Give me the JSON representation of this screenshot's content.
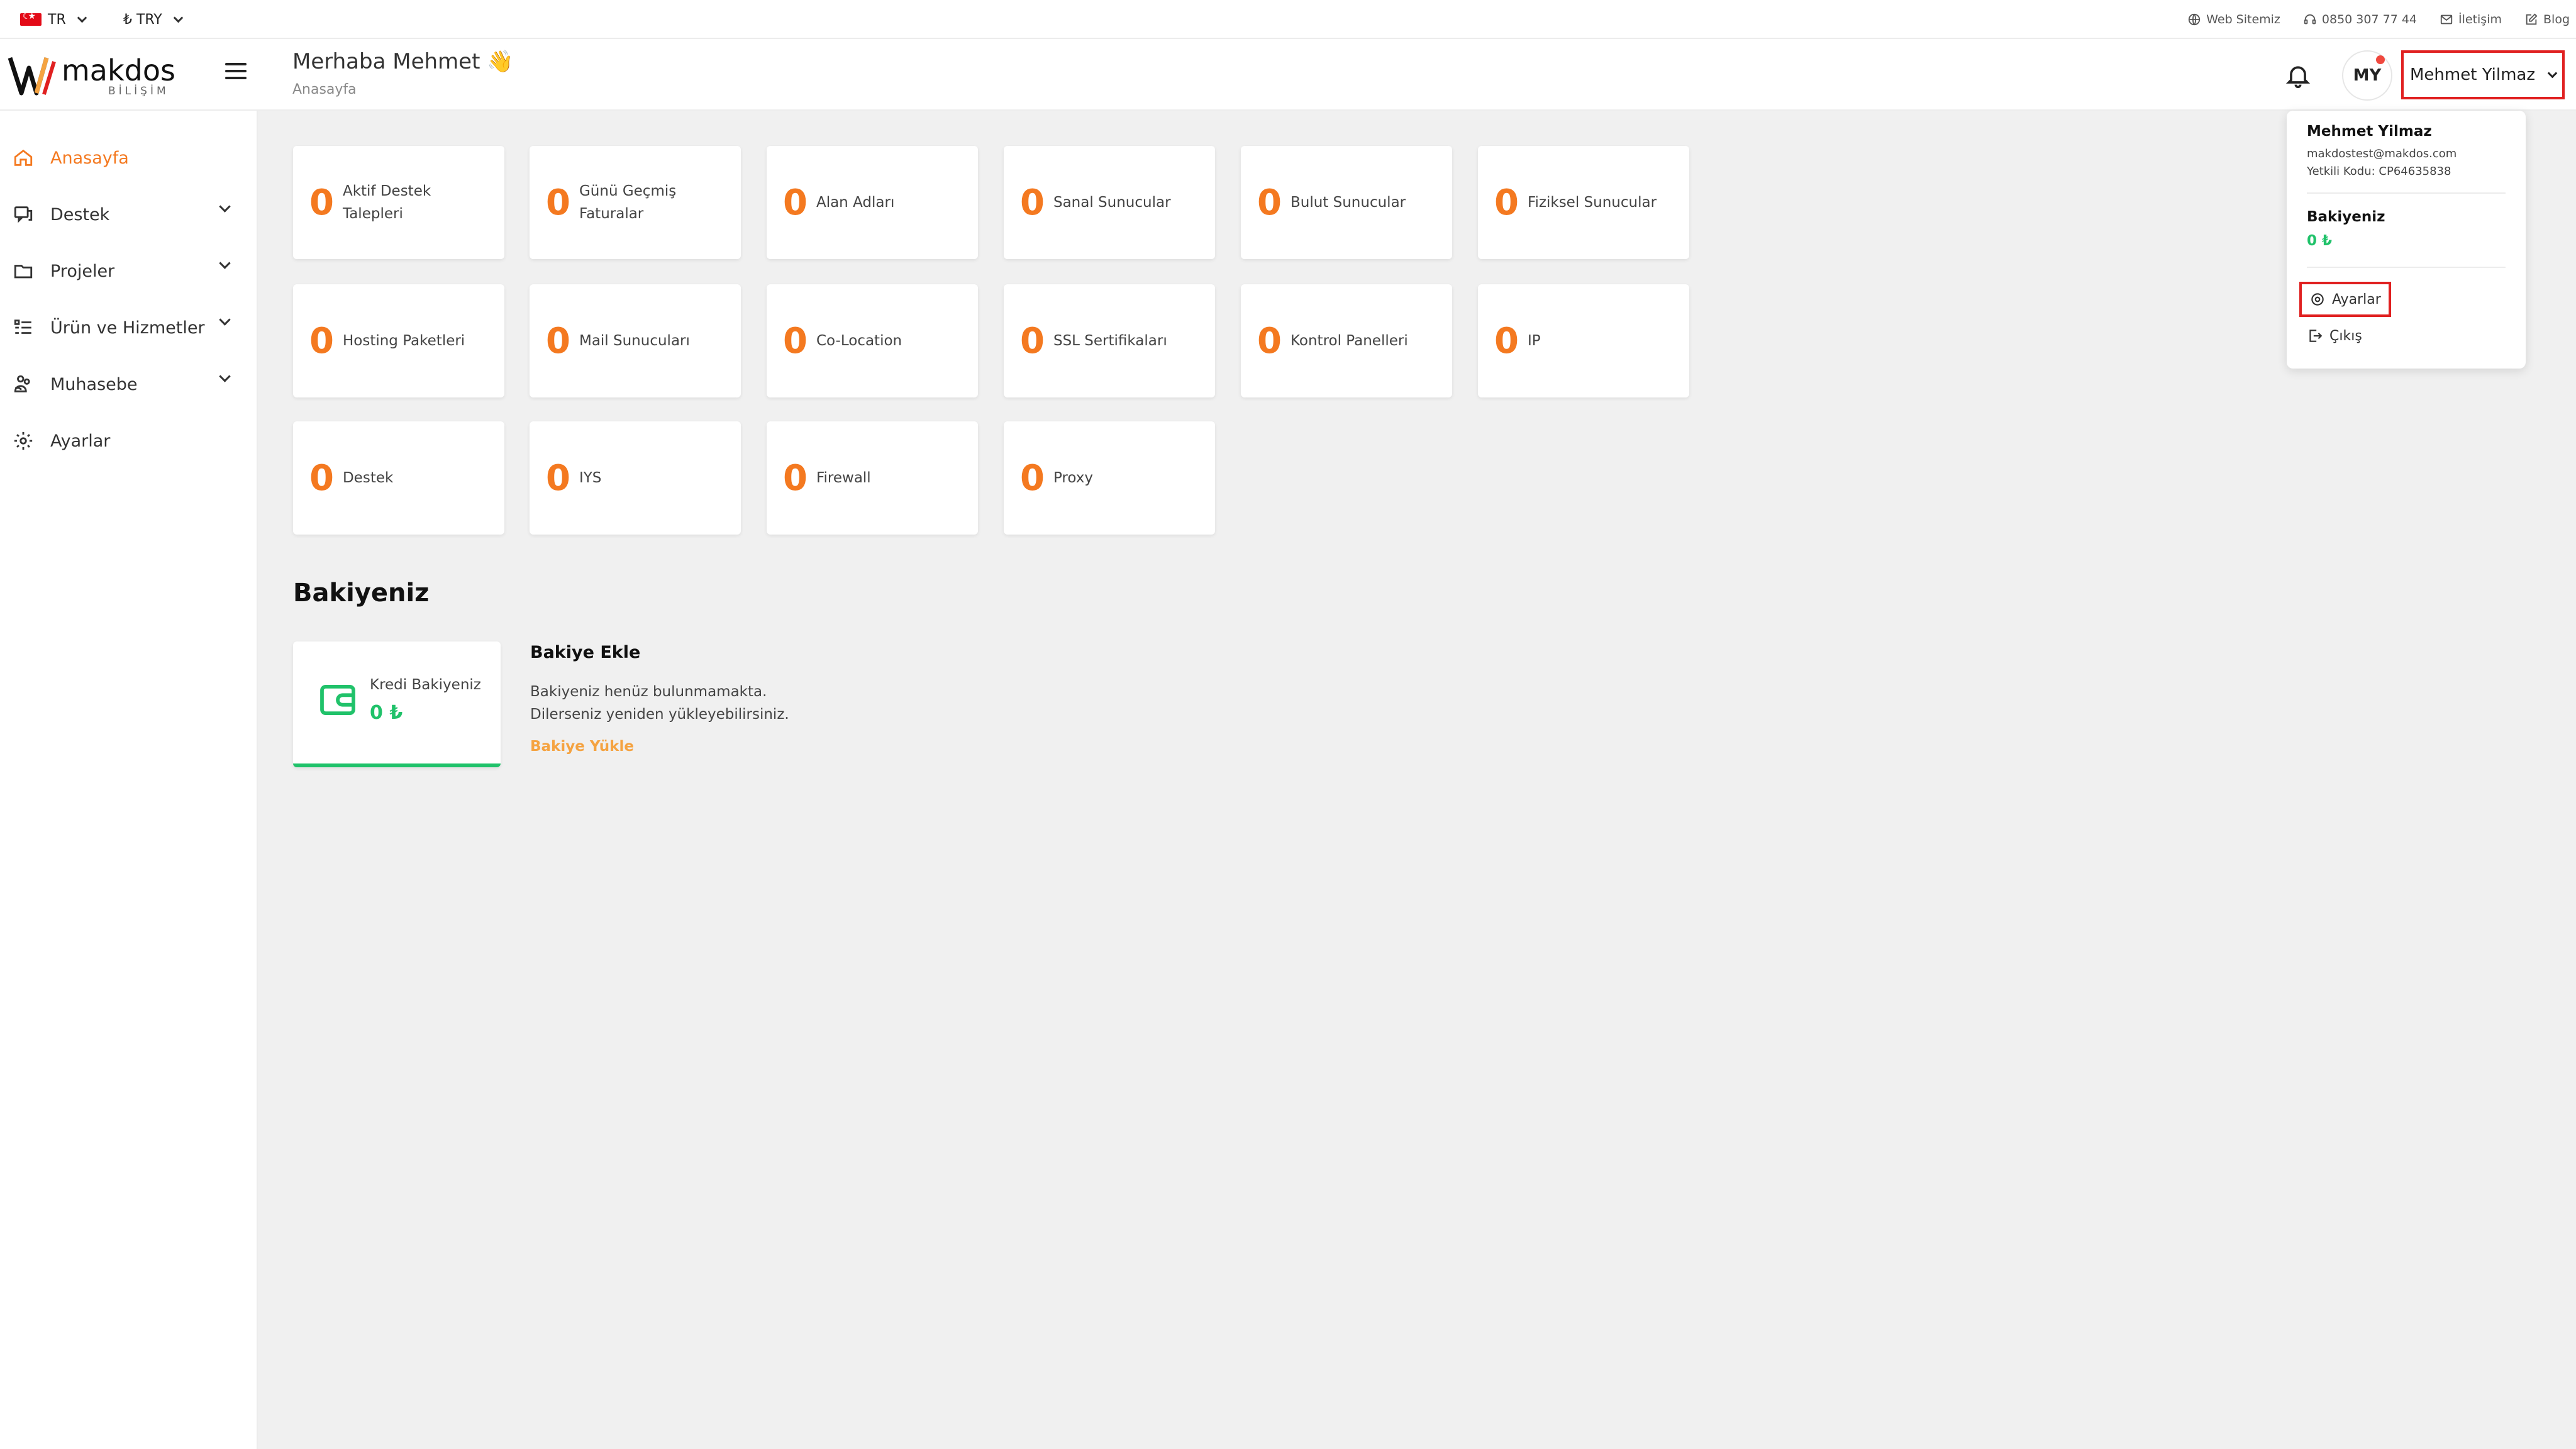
{
  "topbar": {
    "language": "TR",
    "currency": "₺ TRY",
    "links": [
      {
        "icon": "globe-icon",
        "label": "Web Sitemiz"
      },
      {
        "icon": "headset-icon",
        "label": "0850 307 77 44"
      },
      {
        "icon": "mail-icon",
        "label": "İletişim"
      },
      {
        "icon": "edit-icon",
        "label": "Blog"
      }
    ]
  },
  "header": {
    "logo_text": "makdos",
    "logo_subtext": "BİLİŞİM",
    "greeting": "Merhaba Mehmet 👋",
    "breadcrumb": "Anasayfa",
    "avatar_initials": "MY",
    "user_name": "Mehmet Yilmaz"
  },
  "sidebar": {
    "items": [
      {
        "label": "Anasayfa",
        "icon": "home-icon",
        "active": true,
        "expandable": false
      },
      {
        "label": "Destek",
        "icon": "chat-icon",
        "active": false,
        "expandable": true
      },
      {
        "label": "Projeler",
        "icon": "folder-icon",
        "active": false,
        "expandable": true
      },
      {
        "label": "Ürün ve Hizmetler",
        "icon": "list-icon",
        "active": false,
        "expandable": true
      },
      {
        "label": "Muhasebe",
        "icon": "accounting-icon",
        "active": false,
        "expandable": true
      },
      {
        "label": "Ayarlar",
        "icon": "gear-icon",
        "active": false,
        "expandable": false
      }
    ]
  },
  "stats": [
    {
      "count": "0",
      "label": "Aktif Destek Talepleri"
    },
    {
      "count": "0",
      "label": "Günü Geçmiş Faturalar"
    },
    {
      "count": "0",
      "label": "Alan Adları"
    },
    {
      "count": "0",
      "label": "Sanal Sunucular"
    },
    {
      "count": "0",
      "label": "Bulut Sunucular"
    },
    {
      "count": "0",
      "label": "Fiziksel Sunucular"
    },
    {
      "count": "0",
      "label": "Hosting Paketleri"
    },
    {
      "count": "0",
      "label": "Mail Sunucuları"
    },
    {
      "count": "0",
      "label": "Co-Location"
    },
    {
      "count": "0",
      "label": "SSL Sertifikaları"
    },
    {
      "count": "0",
      "label": "Kontrol Panelleri"
    },
    {
      "count": "0",
      "label": "IP"
    },
    {
      "count": "0",
      "label": "Destek"
    },
    {
      "count": "0",
      "label": "IYS"
    },
    {
      "count": "0",
      "label": "Firewall"
    },
    {
      "count": "0",
      "label": "Proxy"
    }
  ],
  "balance": {
    "section_title": "Bakiyeniz",
    "card_label": "Kredi Bakiyeniz",
    "card_value": "0 ₺",
    "add_title": "Bakiye Ekle",
    "add_desc_line1": "Bakiyeniz henüz bulunmamakta.",
    "add_desc_line2": "Dilerseniz yeniden yükleyebilirsiniz.",
    "add_link": "Bakiye Yükle"
  },
  "dropdown": {
    "name": "Mehmet Yilmaz",
    "email": "makdostest@makdos.com",
    "auth_code": "Yetkili Kodu: CP64635838",
    "balance_label": "Bakiyeniz",
    "balance_value": "0 ₺",
    "settings_label": "Ayarlar",
    "logout_label": "Çıkış"
  },
  "colors": {
    "accent": "#f47920",
    "green": "#20c26a",
    "highlight_border": "#e02020"
  }
}
